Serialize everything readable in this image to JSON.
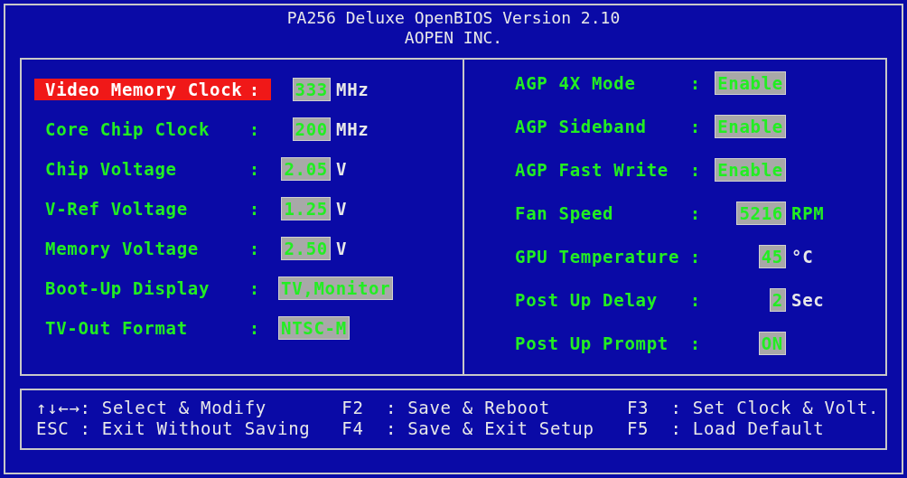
{
  "header": {
    "title": "PA256 Deluxe OpenBIOS Version 2.10",
    "company": "AOPEN INC."
  },
  "left_settings": [
    {
      "label": "Video Memory Clock",
      "separator": ":",
      "value": "333",
      "unit": "MHz",
      "color": "#e8e8e8",
      "selected": true
    },
    {
      "label": "Core Chip Clock",
      "separator": ":",
      "value": "200",
      "unit": "MHz",
      "color": "#e8e8e8",
      "selected": false
    },
    {
      "label": "Chip Voltage",
      "separator": ":",
      "value": "2.05",
      "unit": "V",
      "color": "#e8e8e8",
      "selected": false
    },
    {
      "label": "V-Ref Voltage",
      "separator": ":",
      "value": "1.25",
      "unit": "V",
      "color": "#e8e8e8",
      "selected": false
    },
    {
      "label": "Memory Voltage",
      "separator": ":",
      "value": "2.50",
      "unit": "V",
      "color": "#e8e8e8",
      "selected": false
    },
    {
      "label": "Boot-Up Display",
      "separator": ":",
      "value": "TV,Monitor",
      "selected": false
    },
    {
      "label": "TV-Out Format",
      "separator": ":",
      "value": "NTSC-M",
      "selected": false
    }
  ],
  "right_settings": [
    {
      "label": "AGP 4X Mode",
      "separator": ":",
      "value": "Enable",
      "selected": false
    },
    {
      "label": "AGP Sideband",
      "separator": ":",
      "value": "Enable",
      "selected": false
    },
    {
      "label": "AGP Fast Write",
      "separator": ":",
      "value": "Enable",
      "selected": false
    },
    {
      "label": "Fan Speed",
      "separator": ":",
      "value": "5216",
      "unit": "RPM",
      "color": "#22ee22",
      "selected": false
    },
    {
      "label": "GPU Temperature",
      "separator": ":",
      "value": "45",
      "unit": "°C",
      "color": "#e8e8e8",
      "selected": false
    },
    {
      "label": "Post Up Delay",
      "separator": ":",
      "value": "2",
      "unit": "Sec",
      "color": "#e8e8e8",
      "selected": false
    },
    {
      "label": "Post Up Prompt",
      "separator": ":",
      "value": "ON",
      "selected": false
    }
  ],
  "key_help": [
    [
      "↑↓←→: Select & Modify",
      "ESC : Exit Without Saving"
    ],
    [
      "F2  : Save & Reboot",
      "F4  : Save & Exit Setup"
    ],
    [
      "F3  : Set Clock & Volt.",
      "F5  : Load Default"
    ]
  ]
}
